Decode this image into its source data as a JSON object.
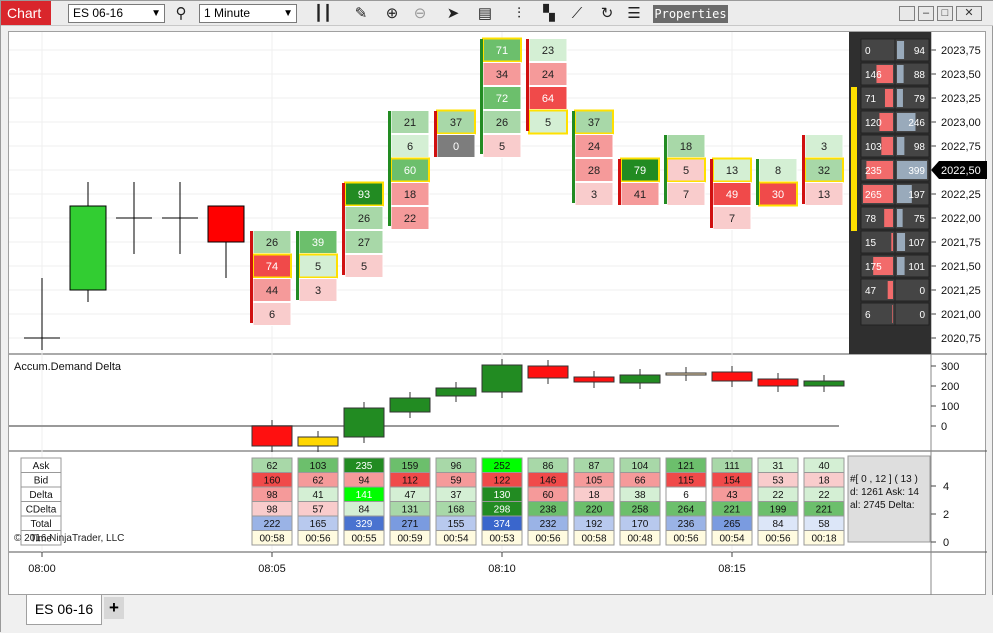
{
  "toolbar": {
    "chart_tab": "Chart",
    "instrument": "ES 06-16",
    "interval": "1 Minute",
    "properties": "Properties",
    "icons": [
      "search-icon",
      "bar-type-icon",
      "pencil-icon",
      "zoom-in-icon",
      "zoom-out-icon",
      "pointer-icon",
      "data-box-icon",
      "indicators-icon",
      "strategies-icon",
      "drawing-tools-icon",
      "reload-icon",
      "object-list-icon"
    ]
  },
  "window": {
    "buttons": [
      "minimize",
      "tile",
      "maximize",
      "close"
    ]
  },
  "tabs": {
    "active": "ES 06-16",
    "add": "+"
  },
  "chart_data": {
    "type": "candlestick-footprint",
    "price_axis": {
      "labels": [
        "2023,75",
        "2023,50",
        "2023,25",
        "2023,00",
        "2022,75",
        "2022,50",
        "2022,25",
        "2022,00",
        "2021,75",
        "2021,50",
        "2021,25",
        "2021,00",
        "2020,75"
      ],
      "current": "2022,50"
    },
    "time_axis": {
      "labels": [
        "08:00",
        "08:05",
        "08:10",
        "08:15"
      ]
    },
    "candles": [
      {
        "o": 2020.75,
        "h": 2021.25,
        "l": 2020.75,
        "c": 2020.75,
        "color": "#ffffff"
      },
      {
        "o": 2021.25,
        "h": 2022.25,
        "l": 2021.25,
        "c": 2022.0,
        "color": "#32cd32"
      },
      {
        "o": 2022.0,
        "h": 2022.25,
        "l": 2021.75,
        "c": 2022.0,
        "color": "#ffffff"
      },
      {
        "o": 2022.0,
        "h": 2022.25,
        "l": 2021.75,
        "c": 2022.0,
        "color": "#ffffff"
      },
      {
        "o": 2022.0,
        "h": 2022.0,
        "l": 2021.5,
        "c": 2021.75,
        "color": "#ff0000"
      }
    ],
    "footprint_bars": [
      {
        "top": 2021.75,
        "cells": [
          26,
          74,
          44,
          6
        ],
        "shade": [
          "lg",
          "r",
          "lr",
          "vlr"
        ],
        "poc": 1
      },
      {
        "top": 2021.75,
        "cells": [
          39,
          5,
          3
        ],
        "shade": [
          "g",
          "vlg",
          "vlr"
        ],
        "poc": 1
      },
      {
        "top": 2022.25,
        "cells": [
          93,
          26,
          27,
          5
        ],
        "shade": [
          "dg",
          "lg",
          "lg",
          "vlr"
        ],
        "poc": 0
      },
      {
        "top": 2023.0,
        "cells": [
          21,
          6,
          60,
          18,
          22
        ],
        "shade": [
          "lg",
          "vlg",
          "g",
          "lr",
          "lr"
        ],
        "poc": 2
      },
      {
        "top": 2023.0,
        "cells": [
          37,
          0
        ],
        "shade": [
          "lg",
          "gr"
        ],
        "poc": 0
      },
      {
        "top": 2023.75,
        "cells": [
          71,
          34,
          72,
          26,
          5
        ],
        "shade": [
          "g",
          "lr",
          "g",
          "lg",
          "vlr"
        ],
        "poc": 0
      },
      {
        "top": 2023.75,
        "cells": [
          23,
          24,
          64,
          5
        ],
        "shade": [
          "vlg",
          "lr",
          "r",
          "vlg"
        ],
        "poc": 3
      },
      {
        "top": 2023.0,
        "cells": [
          37,
          24,
          28,
          3
        ],
        "shade": [
          "lg",
          "lr",
          "lr",
          "vlr"
        ],
        "poc": 0
      },
      {
        "top": 2022.5,
        "cells": [
          79,
          41
        ],
        "shade": [
          "dg",
          "lr"
        ],
        "poc": 0
      },
      {
        "top": 2022.75,
        "cells": [
          18,
          5,
          7
        ],
        "shade": [
          "lg",
          "vlr",
          "vlr"
        ],
        "poc": 1
      },
      {
        "top": 2022.5,
        "cells": [
          13,
          49,
          7
        ],
        "shade": [
          "vlg",
          "r",
          "vlr"
        ],
        "poc": 0
      },
      {
        "top": 2022.5,
        "cells": [
          8,
          30
        ],
        "shade": [
          "vlg",
          "r"
        ],
        "poc": 1
      },
      {
        "top": 2022.75,
        "cells": [
          3,
          32,
          13
        ],
        "shade": [
          "vlg",
          "lg",
          "vlr"
        ],
        "poc": 1
      }
    ],
    "dom_ladder": [
      {
        "bid": 0,
        "ask": 94
      },
      {
        "bid": 146,
        "ask": 88
      },
      {
        "bid": 71,
        "ask": 79
      },
      {
        "bid": 120,
        "ask": 246
      },
      {
        "bid": 103,
        "ask": 98
      },
      {
        "bid": 235,
        "ask": 399
      },
      {
        "bid": 265,
        "ask": 197
      },
      {
        "bid": 78,
        "ask": 75
      },
      {
        "bid": 15,
        "ask": 107
      },
      {
        "bid": 175,
        "ask": 101
      },
      {
        "bid": 47,
        "ask": 0
      },
      {
        "bid": 6,
        "ask": 0
      }
    ],
    "delta_panel": {
      "title": "Accum.Demand Delta",
      "y_labels": [
        "300",
        "200",
        "100",
        "0"
      ],
      "boxes": [
        {
          "o": 0,
          "c": -100,
          "color": "#ff1010"
        },
        {
          "o": -55,
          "c": -100,
          "color": "#ffd700"
        },
        {
          "o": -55,
          "c": 90,
          "color": "#228b22"
        },
        {
          "o": 70,
          "c": 140,
          "color": "#228b22"
        },
        {
          "o": 150,
          "c": 190,
          "color": "#228b22"
        },
        {
          "o": 170,
          "c": 305,
          "color": "#228b22"
        },
        {
          "o": 300,
          "c": 240,
          "color": "#ff1010"
        },
        {
          "o": 245,
          "c": 220,
          "color": "#ff1010"
        },
        {
          "o": 215,
          "c": 255,
          "color": "#228b22"
        },
        {
          "o": 255,
          "c": 265,
          "color": "#f5deb3"
        },
        {
          "o": 270,
          "c": 225,
          "color": "#ff1010"
        },
        {
          "o": 235,
          "c": 200,
          "color": "#ff1010"
        },
        {
          "o": 200,
          "c": 225,
          "color": "#228b22"
        }
      ]
    },
    "stats": {
      "row_labels": [
        "Ask",
        "Bid",
        "Delta",
        "CDelta",
        "Total",
        "Time"
      ],
      "y_labels": [
        "4",
        "2",
        "0"
      ],
      "columns": [
        {
          "ask": "62",
          "bid": "160",
          "delta": "98",
          "cdelta": "98",
          "total": "222",
          "time": "00:58"
        },
        {
          "ask": "103",
          "bid": "62",
          "delta": "41",
          "cdelta": "57",
          "total": "165",
          "time": "00:56"
        },
        {
          "ask": "235",
          "bid": "94",
          "delta": "141",
          "cdelta": "84",
          "total": "329",
          "time": "00:55"
        },
        {
          "ask": "159",
          "bid": "112",
          "delta": "47",
          "cdelta": "131",
          "total": "271",
          "time": "00:59"
        },
        {
          "ask": "96",
          "bid": "59",
          "delta": "37",
          "cdelta": "168",
          "total": "155",
          "time": "00:54"
        },
        {
          "ask": "252",
          "bid": "122",
          "delta": "130",
          "cdelta": "298",
          "total": "374",
          "time": "00:53"
        },
        {
          "ask": "86",
          "bid": "146",
          "delta": "60",
          "cdelta": "238",
          "total": "232",
          "time": "00:56"
        },
        {
          "ask": "87",
          "bid": "105",
          "delta": "18",
          "cdelta": "220",
          "total": "192",
          "time": "00:58"
        },
        {
          "ask": "104",
          "bid": "66",
          "delta": "38",
          "cdelta": "258",
          "total": "170",
          "time": "00:48"
        },
        {
          "ask": "121",
          "bid": "115",
          "delta": "6",
          "cdelta": "264",
          "total": "236",
          "time": "00:56"
        },
        {
          "ask": "111",
          "bid": "154",
          "delta": "43",
          "cdelta": "221",
          "total": "265",
          "time": "00:54"
        },
        {
          "ask": "31",
          "bid": "53",
          "delta": "22",
          "cdelta": "199",
          "total": "84",
          "time": "00:56"
        },
        {
          "ask": "40",
          "bid": "18",
          "delta": "22",
          "cdelta": "221",
          "total": "58",
          "time": "00:18"
        }
      ],
      "info_lines": [
        "#[ 0 , 12 ]   ( 13 )",
        "d: 1261     Ask: 14",
        "al: 2745    Delta:"
      ]
    },
    "copyright": "© 2016 NinjaTrader, LLC"
  }
}
